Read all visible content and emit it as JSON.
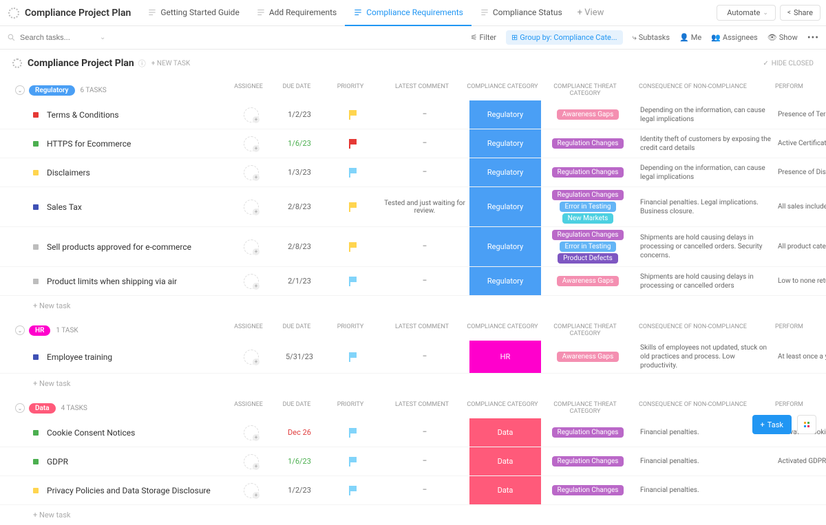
{
  "project_name": "Compliance Project Plan",
  "tabs": [
    {
      "label": "Getting Started Guide",
      "active": false
    },
    {
      "label": "Add Requirements",
      "active": false
    },
    {
      "label": "Compliance Requirements",
      "active": true
    },
    {
      "label": "Compliance Status",
      "active": false
    }
  ],
  "view_btn": "+ View",
  "automate": "Automate",
  "share": "Share",
  "search_placeholder": "Search tasks...",
  "toolbar": {
    "filter": "Filter",
    "group_by": "Group by: Compliance Cate...",
    "subtasks": "Subtasks",
    "me": "Me",
    "assignees": "Assignees",
    "show": "Show"
  },
  "page_title": "Compliance Project Plan",
  "new_task_label": "+ NEW TASK",
  "hide_closed": "HIDE CLOSED",
  "new_task_row": "+ New task",
  "columns": {
    "assignee": "ASSIGNEE",
    "due_date": "DUE DATE",
    "priority": "PRIORITY",
    "latest_comment": "LATEST COMMENT",
    "compliance_category": "COMPLIANCE CATEGORY",
    "threat": "COMPLIANCE THREAT CATEGORY",
    "consequence": "CONSEQUENCE OF NON-COMPLIANCE",
    "perform": "PERFORM"
  },
  "threat_colors": {
    "Awareness Gaps": "#f48fb1",
    "Regulation Changes": "#ba68c8",
    "Error in Testing": "#64b5f6",
    "New Markets": "#4dd0e1",
    "Product Defects": "#7e57c2"
  },
  "groups": [
    {
      "name": "Regulatory",
      "badge_color": "#4a9ff5",
      "count": "6 TASKS",
      "cat_class": "cat-regulatory",
      "cat_label": "Regulatory",
      "tasks": [
        {
          "sq": "#e53935",
          "title": "Terms & Conditions",
          "due": "1/2/23",
          "due_class": "",
          "flag": "#ffd54f",
          "comment": "–",
          "threats": [
            "Awareness Gaps"
          ],
          "consequence": "Depending on the information, can cause legal implications",
          "perform": "Presence of Terms a"
        },
        {
          "sq": "#4caf50",
          "title": "HTTPS for Ecommerce",
          "due": "1/6/23",
          "due_class": "green-date",
          "flag": "#e53935",
          "comment": "–",
          "threats": [
            "Regulation Changes"
          ],
          "consequence": "Identity theft of customers by exposing the credit card details",
          "perform": "Active Certificate fo"
        },
        {
          "sq": "#ffd54f",
          "title": "Disclaimers",
          "due": "1/3/23",
          "due_class": "",
          "flag": "#81d4fa",
          "comment": "–",
          "threats": [
            "Regulation Changes"
          ],
          "consequence": "Depending on the information, can cause legal implications",
          "perform": "Presence of Disclain"
        },
        {
          "sq": "#3f51b5",
          "title": "Sales Tax",
          "due": "2/8/23",
          "due_class": "",
          "flag": "#ffd54f",
          "comment": "Tested and just waiting for review.",
          "threats": [
            "Regulation Changes",
            "Error in Testing",
            "New Markets"
          ],
          "consequence": "Financial penalties. Legal implications. Business closure.",
          "perform": "All sales include sal"
        },
        {
          "sq": "#bdbdbd",
          "title": "Sell products approved for e-commerce",
          "due": "2/8/23",
          "due_class": "",
          "flag": "#ffd54f",
          "comment": "–",
          "threats": [
            "Regulation Changes",
            "Error in Testing",
            "Product Defects"
          ],
          "consequence": "Shipments are hold causing delays in processing or cancelled orders. Security concerns.",
          "perform": "All product categori the approved produ"
        },
        {
          "sq": "#bdbdbd",
          "title": "Product limits when shipping via air",
          "due": "2/1/23",
          "due_class": "",
          "flag": "#81d4fa",
          "comment": "–",
          "threats": [
            "Awareness Gaps"
          ],
          "consequence": "Shipments are hold causing delays in processing or cancelled orders",
          "perform": "Low to none returns via air constraint"
        }
      ]
    },
    {
      "name": "HR",
      "badge_color": "#ff00cc",
      "count": "1 TASK",
      "cat_class": "cat-hr",
      "cat_label": "HR",
      "tasks": [
        {
          "sq": "#3f51b5",
          "title": "Employee training",
          "due": "5/31/23",
          "due_class": "",
          "flag": "#81d4fa",
          "comment": "–",
          "threats": [
            "Awareness Gaps"
          ],
          "consequence": "Skills of employees not updated, stuck on old practices and process. Low productivity.",
          "perform": "At least once a year"
        }
      ]
    },
    {
      "name": "Data",
      "badge_color": "#ff5a7a",
      "count": "4 TASKS",
      "cat_class": "cat-data",
      "cat_label": "Data",
      "tasks": [
        {
          "sq": "#4caf50",
          "title": "Cookie Consent Notices",
          "due": "Dec 26",
          "due_class": "red-date",
          "flag": "#81d4fa",
          "comment": "–",
          "threats": [
            "Regulation Changes"
          ],
          "consequence": "Financial penalties.",
          "perform": "Activated Cookie Co"
        },
        {
          "sq": "#4caf50",
          "title": "GDPR",
          "due": "1/6/23",
          "due_class": "green-date",
          "flag": "#81d4fa",
          "comment": "–",
          "threats": [
            "Regulation Changes"
          ],
          "consequence": "Financial penalties.",
          "perform": "Activated GDPR"
        },
        {
          "sq": "#ffd54f",
          "title": "Privacy Policies and Data Storage Disclosure",
          "due": "1/2/23",
          "due_class": "",
          "flag": "#81d4fa",
          "comment": "–",
          "threats": [
            "Regulation Changes"
          ],
          "consequence": "Financial penalties.",
          "perform": ""
        }
      ]
    }
  ],
  "float_task": "Task"
}
